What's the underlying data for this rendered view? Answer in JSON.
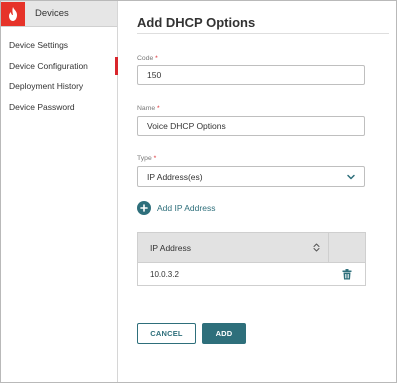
{
  "sidebar": {
    "brand_title": "Devices",
    "items": [
      {
        "label": "Device Settings",
        "active": false
      },
      {
        "label": "Device Configuration",
        "active": true
      },
      {
        "label": "Deployment History",
        "active": false
      },
      {
        "label": "Device Password",
        "active": false
      }
    ]
  },
  "form": {
    "title": "Add DHCP Options",
    "code": {
      "label": "Code",
      "required_mark": "*",
      "value": "150"
    },
    "name": {
      "label": "Name",
      "required_mark": "*",
      "value": "Voice DHCP Options"
    },
    "type": {
      "label": "Type",
      "required_mark": "*",
      "selected": "IP Address(es)"
    },
    "add_ip_label": "Add IP Address",
    "table": {
      "column_header": "IP Address",
      "rows": [
        {
          "ip": "10.0.3.2"
        }
      ]
    },
    "cancel_label": "CANCEL",
    "add_label": "ADD"
  },
  "colors": {
    "accent": "#2e6f7b",
    "brand_red": "#e63329",
    "active_marker": "#d9262c"
  }
}
